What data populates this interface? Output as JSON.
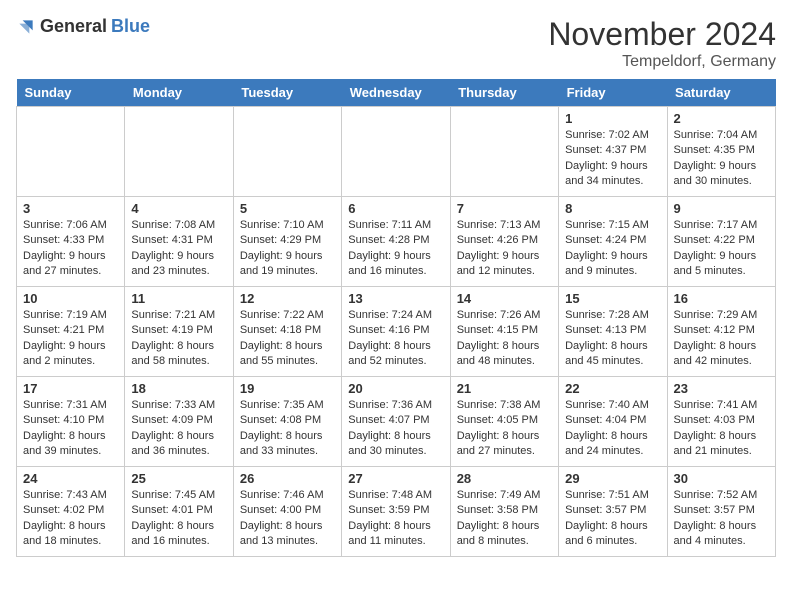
{
  "logo": {
    "general": "General",
    "blue": "Blue"
  },
  "title": "November 2024",
  "subtitle": "Tempeldorf, Germany",
  "weekdays": [
    "Sunday",
    "Monday",
    "Tuesday",
    "Wednesday",
    "Thursday",
    "Friday",
    "Saturday"
  ],
  "weeks": [
    [
      {
        "day": "",
        "info": ""
      },
      {
        "day": "",
        "info": ""
      },
      {
        "day": "",
        "info": ""
      },
      {
        "day": "",
        "info": ""
      },
      {
        "day": "",
        "info": ""
      },
      {
        "day": "1",
        "info": "Sunrise: 7:02 AM\nSunset: 4:37 PM\nDaylight: 9 hours and 34 minutes."
      },
      {
        "day": "2",
        "info": "Sunrise: 7:04 AM\nSunset: 4:35 PM\nDaylight: 9 hours and 30 minutes."
      }
    ],
    [
      {
        "day": "3",
        "info": "Sunrise: 7:06 AM\nSunset: 4:33 PM\nDaylight: 9 hours and 27 minutes."
      },
      {
        "day": "4",
        "info": "Sunrise: 7:08 AM\nSunset: 4:31 PM\nDaylight: 9 hours and 23 minutes."
      },
      {
        "day": "5",
        "info": "Sunrise: 7:10 AM\nSunset: 4:29 PM\nDaylight: 9 hours and 19 minutes."
      },
      {
        "day": "6",
        "info": "Sunrise: 7:11 AM\nSunset: 4:28 PM\nDaylight: 9 hours and 16 minutes."
      },
      {
        "day": "7",
        "info": "Sunrise: 7:13 AM\nSunset: 4:26 PM\nDaylight: 9 hours and 12 minutes."
      },
      {
        "day": "8",
        "info": "Sunrise: 7:15 AM\nSunset: 4:24 PM\nDaylight: 9 hours and 9 minutes."
      },
      {
        "day": "9",
        "info": "Sunrise: 7:17 AM\nSunset: 4:22 PM\nDaylight: 9 hours and 5 minutes."
      }
    ],
    [
      {
        "day": "10",
        "info": "Sunrise: 7:19 AM\nSunset: 4:21 PM\nDaylight: 9 hours and 2 minutes."
      },
      {
        "day": "11",
        "info": "Sunrise: 7:21 AM\nSunset: 4:19 PM\nDaylight: 8 hours and 58 minutes."
      },
      {
        "day": "12",
        "info": "Sunrise: 7:22 AM\nSunset: 4:18 PM\nDaylight: 8 hours and 55 minutes."
      },
      {
        "day": "13",
        "info": "Sunrise: 7:24 AM\nSunset: 4:16 PM\nDaylight: 8 hours and 52 minutes."
      },
      {
        "day": "14",
        "info": "Sunrise: 7:26 AM\nSunset: 4:15 PM\nDaylight: 8 hours and 48 minutes."
      },
      {
        "day": "15",
        "info": "Sunrise: 7:28 AM\nSunset: 4:13 PM\nDaylight: 8 hours and 45 minutes."
      },
      {
        "day": "16",
        "info": "Sunrise: 7:29 AM\nSunset: 4:12 PM\nDaylight: 8 hours and 42 minutes."
      }
    ],
    [
      {
        "day": "17",
        "info": "Sunrise: 7:31 AM\nSunset: 4:10 PM\nDaylight: 8 hours and 39 minutes."
      },
      {
        "day": "18",
        "info": "Sunrise: 7:33 AM\nSunset: 4:09 PM\nDaylight: 8 hours and 36 minutes."
      },
      {
        "day": "19",
        "info": "Sunrise: 7:35 AM\nSunset: 4:08 PM\nDaylight: 8 hours and 33 minutes."
      },
      {
        "day": "20",
        "info": "Sunrise: 7:36 AM\nSunset: 4:07 PM\nDaylight: 8 hours and 30 minutes."
      },
      {
        "day": "21",
        "info": "Sunrise: 7:38 AM\nSunset: 4:05 PM\nDaylight: 8 hours and 27 minutes."
      },
      {
        "day": "22",
        "info": "Sunrise: 7:40 AM\nSunset: 4:04 PM\nDaylight: 8 hours and 24 minutes."
      },
      {
        "day": "23",
        "info": "Sunrise: 7:41 AM\nSunset: 4:03 PM\nDaylight: 8 hours and 21 minutes."
      }
    ],
    [
      {
        "day": "24",
        "info": "Sunrise: 7:43 AM\nSunset: 4:02 PM\nDaylight: 8 hours and 18 minutes."
      },
      {
        "day": "25",
        "info": "Sunrise: 7:45 AM\nSunset: 4:01 PM\nDaylight: 8 hours and 16 minutes."
      },
      {
        "day": "26",
        "info": "Sunrise: 7:46 AM\nSunset: 4:00 PM\nDaylight: 8 hours and 13 minutes."
      },
      {
        "day": "27",
        "info": "Sunrise: 7:48 AM\nSunset: 3:59 PM\nDaylight: 8 hours and 11 minutes."
      },
      {
        "day": "28",
        "info": "Sunrise: 7:49 AM\nSunset: 3:58 PM\nDaylight: 8 hours and 8 minutes."
      },
      {
        "day": "29",
        "info": "Sunrise: 7:51 AM\nSunset: 3:57 PM\nDaylight: 8 hours and 6 minutes."
      },
      {
        "day": "30",
        "info": "Sunrise: 7:52 AM\nSunset: 3:57 PM\nDaylight: 8 hours and 4 minutes."
      }
    ]
  ]
}
